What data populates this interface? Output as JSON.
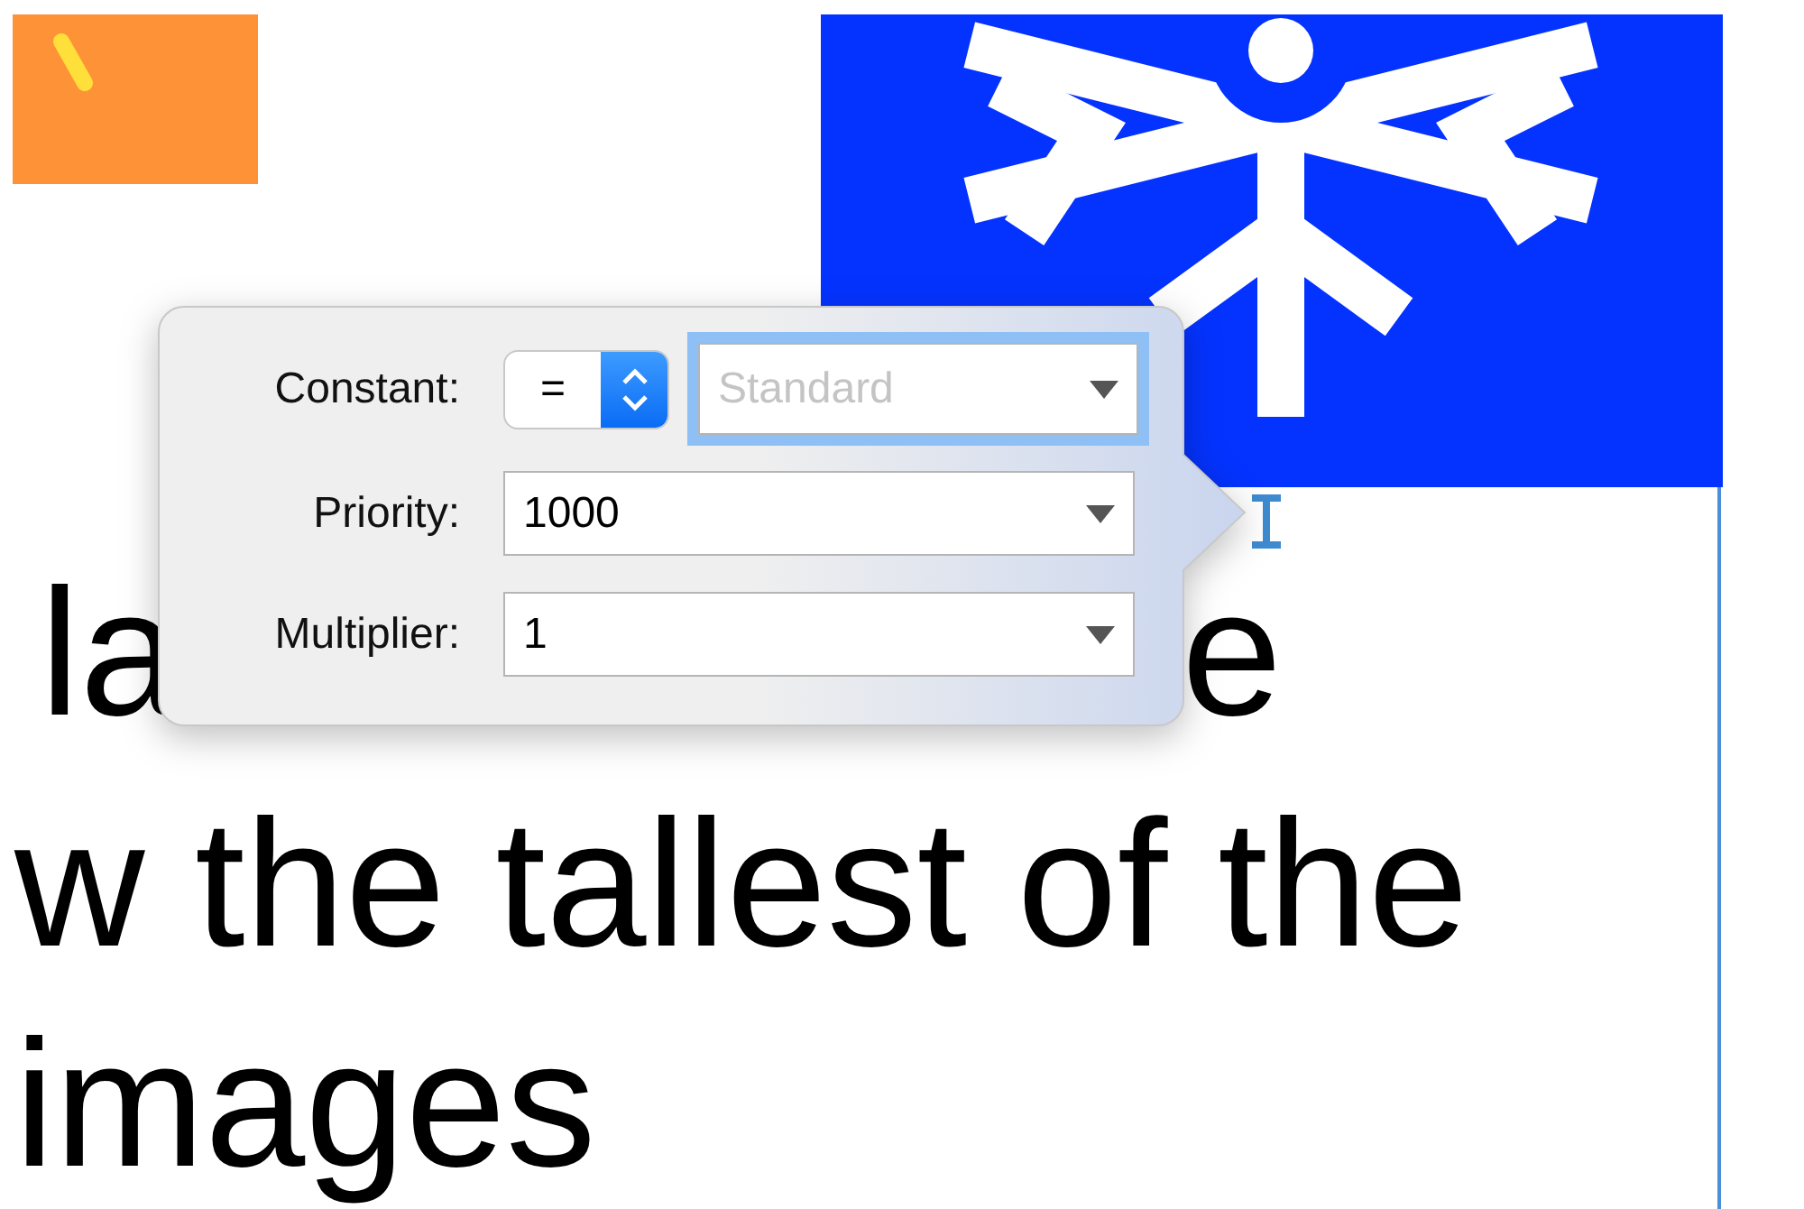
{
  "label": {
    "line_1_start": "la",
    "line_1_end": "e",
    "lines": [
      "w the tallest of the",
      "images"
    ]
  },
  "popover": {
    "rows": [
      {
        "label": "Constant:",
        "kind": "relation",
        "relation": "=",
        "field": {
          "placeholder": "Standard",
          "focused": true
        }
      },
      {
        "label": "Priority:",
        "kind": "combo",
        "value": "1000"
      },
      {
        "label": "Multiplier:",
        "kind": "combo",
        "value": "1"
      }
    ]
  }
}
